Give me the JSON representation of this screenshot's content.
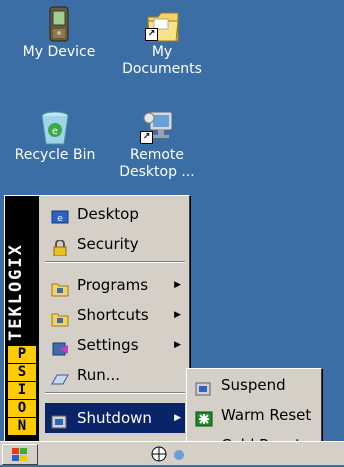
{
  "desktop": {
    "icons": [
      {
        "label": "My Device",
        "icon": "device-icon"
      },
      {
        "label": "My\nDocuments",
        "icon": "folder-shortcut-icon"
      },
      {
        "label": "Recycle Bin",
        "icon": "recycle-bin-icon"
      },
      {
        "label": "Remote\nDesktop ...",
        "icon": "remote-desktop-icon"
      }
    ]
  },
  "start_menu": {
    "brand": "TEKLOGIX",
    "psion_letters": [
      "P",
      "S",
      "I",
      "O",
      "N"
    ],
    "items": [
      {
        "label": "Desktop",
        "icon": "desktop-icon",
        "submenu": false
      },
      {
        "label": "Security",
        "icon": "lock-icon",
        "submenu": false
      },
      {
        "label": "Programs",
        "icon": "folder-icon",
        "submenu": true
      },
      {
        "label": "Shortcuts",
        "icon": "folder-icon",
        "submenu": true
      },
      {
        "label": "Settings",
        "icon": "settings-icon",
        "submenu": true
      },
      {
        "label": "Run...",
        "icon": "run-icon",
        "submenu": false
      },
      {
        "label": "Shutdown",
        "icon": "shutdown-icon",
        "submenu": true
      }
    ],
    "arrow": "▶"
  },
  "shutdown_submenu": {
    "items": [
      {
        "label": "Suspend",
        "icon": "suspend-icon"
      },
      {
        "label": "Warm Reset",
        "icon": "warm-reset-icon"
      },
      {
        "label": "Cold Reset",
        "icon": "cold-reset-icon"
      }
    ]
  },
  "colors": {
    "desktop": "#3a6ea5",
    "menu": "#d4d0c8",
    "selection": "#0a246a",
    "brand": "#ffcc00"
  }
}
